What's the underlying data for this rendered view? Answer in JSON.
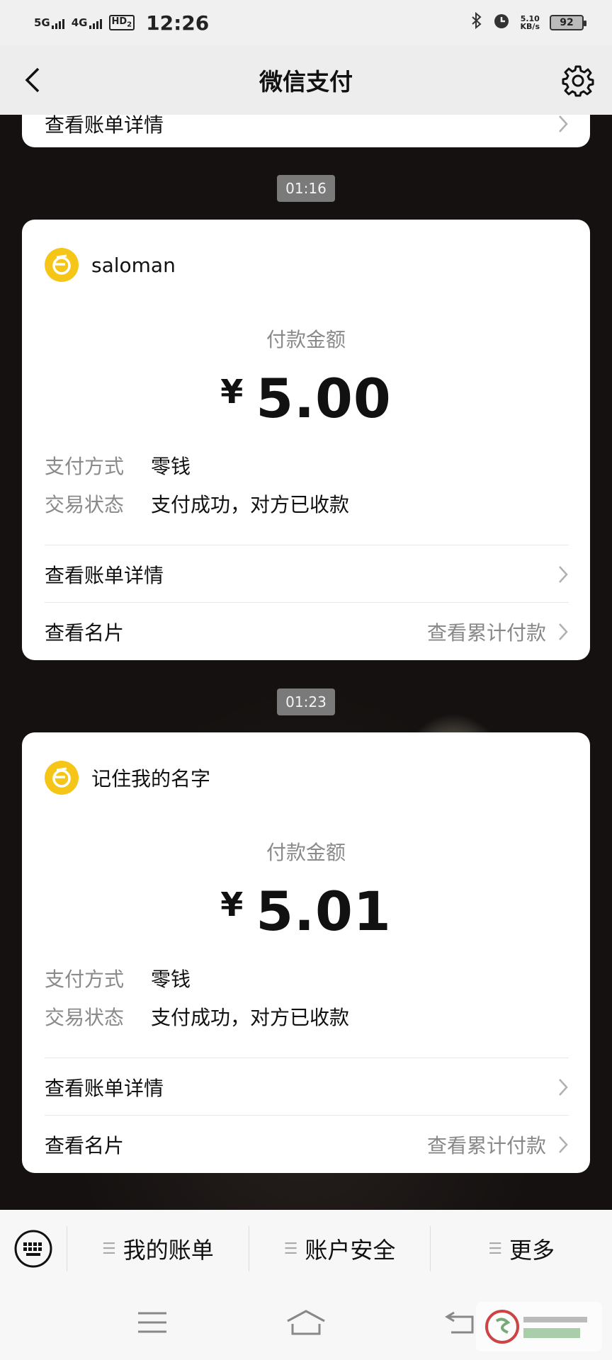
{
  "status_bar": {
    "signal_1": "5G",
    "signal_2": "4G",
    "hd": "HD",
    "hd_sub": "2",
    "time": "12:26",
    "net_speed": "5.10",
    "net_unit": "KB/s",
    "battery": "92"
  },
  "header": {
    "title": "微信支付",
    "back_icon": "chevron-left-icon",
    "settings_icon": "gear-icon"
  },
  "partial_card": {
    "link_label": "查看账单详情"
  },
  "messages": [
    {
      "timestamp": "01:16",
      "payee": "saloman",
      "amount_label": "付款金额",
      "currency": "¥",
      "amount": "5.00",
      "method_key": "支付方式",
      "method_value": "零钱",
      "status_key": "交易状态",
      "status_value": "支付成功，对方已收款",
      "bill_link": "查看账单详情",
      "card_link": "查看名片",
      "cumulative_link": "查看累计付款"
    },
    {
      "timestamp": "01:23",
      "payee": "记住我的名字",
      "amount_label": "付款金额",
      "currency": "¥",
      "amount": "5.01",
      "method_key": "支付方式",
      "method_value": "零钱",
      "status_key": "交易状态",
      "status_value": "支付成功，对方已收款",
      "bill_link": "查看账单详情",
      "card_link": "查看名片",
      "cumulative_link": "查看累计付款"
    }
  ],
  "bottom_menu": {
    "items": [
      {
        "label": "我的账单"
      },
      {
        "label": "账户安全"
      },
      {
        "label": "更多"
      }
    ],
    "keyboard_icon": "keyboard-icon"
  },
  "system_nav": {
    "menu_icon": "menu-icon",
    "home_icon": "home-icon",
    "back_icon": "back-icon"
  },
  "colors": {
    "accent": "#f5c518",
    "nav_bg": "#ededed",
    "timestamp_bg": "#7a7a7a"
  }
}
